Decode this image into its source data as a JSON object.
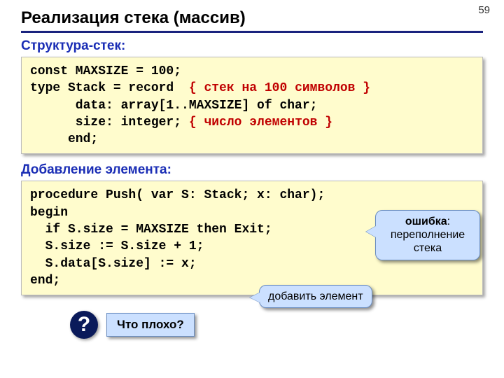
{
  "page_number": "59",
  "title": "Реализация стека (массив)",
  "section1": "Структура-стек:",
  "code1": {
    "l1a": "const MAXSIZE = 100;",
    "l2a": "type Stack = record  ",
    "l2c": "{ стек на 100 символов }",
    "l3a": "      data: array[1..MAXSIZE] of char;",
    "l4a": "      size: integer; ",
    "l4c": "{ число элементов }",
    "l5a": "     end;"
  },
  "section2": "Добавление элемента:",
  "code2": {
    "l1": "procedure Push( var S: Stack; x: char);",
    "l2": "begin",
    "l3": "  if S.size = MAXSIZE then Exit;",
    "l4": "  S.size := S.size + 1;",
    "l5": "  S.data[S.size] := x;",
    "l6": "end;"
  },
  "callout_error": {
    "head": "ошибка",
    "rest": ": переполнение стека"
  },
  "callout_add": "добавить элемент",
  "question_mark": "?",
  "question_text": "Что плохо?"
}
